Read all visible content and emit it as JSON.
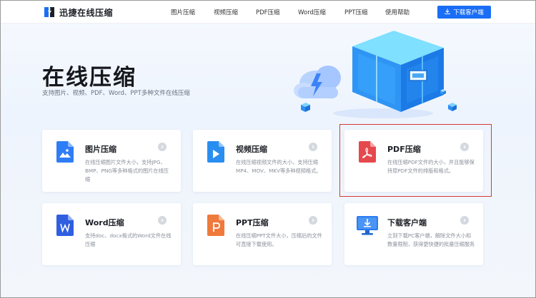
{
  "header": {
    "logo_text": "迅捷在线压缩",
    "nav": [
      {
        "label": "图片压缩"
      },
      {
        "label": "视频压缩"
      },
      {
        "label": "PDF压缩"
      },
      {
        "label": "Word压缩"
      },
      {
        "label": "PPT压缩"
      },
      {
        "label": "使用帮助"
      }
    ],
    "download_label": "下载客户端"
  },
  "hero": {
    "title": "在线压缩",
    "subtitle": "支持图片、视频、PDF、Word、PPT多种文件在线压缩"
  },
  "cards": [
    {
      "title": "图片压缩",
      "desc": "在线压缩图片文件大小，支持JPG、BMP、PNG等多种格式的图片在线压缩",
      "icon": "image-file-icon"
    },
    {
      "title": "视频压缩",
      "desc": "在线压缩视频文件的大小，支持压缩MP4、MOV、MKV等多种视频格式。",
      "icon": "video-file-icon"
    },
    {
      "title": "PDF压缩",
      "desc": "在线压缩PDF文件的大小，并且能够保持原PDF文件的排版和格式。",
      "icon": "pdf-file-icon"
    },
    {
      "title": "Word压缩",
      "desc": "支持doc、docx格式的Word文件在线压缩",
      "icon": "word-file-icon"
    },
    {
      "title": "PPT压缩",
      "desc": "在线压缩PPT文件大小，压缩后的文件可直接下载使用。",
      "icon": "ppt-file-icon"
    },
    {
      "title": "下载客户端",
      "desc": "立刻下载PC客户端，解除文件大小和数量限制，获得更快捷的批量压缩服务",
      "icon": "monitor-download-icon"
    }
  ],
  "colors": {
    "accent": "#1a6ef5",
    "image_icon": "#2f7df6",
    "video_icon": "#2a8ef0",
    "pdf_icon": "#e5484d",
    "word_icon": "#2f5fe0",
    "ppt_icon": "#f07a3c",
    "highlight_border": "#d23b3b"
  }
}
